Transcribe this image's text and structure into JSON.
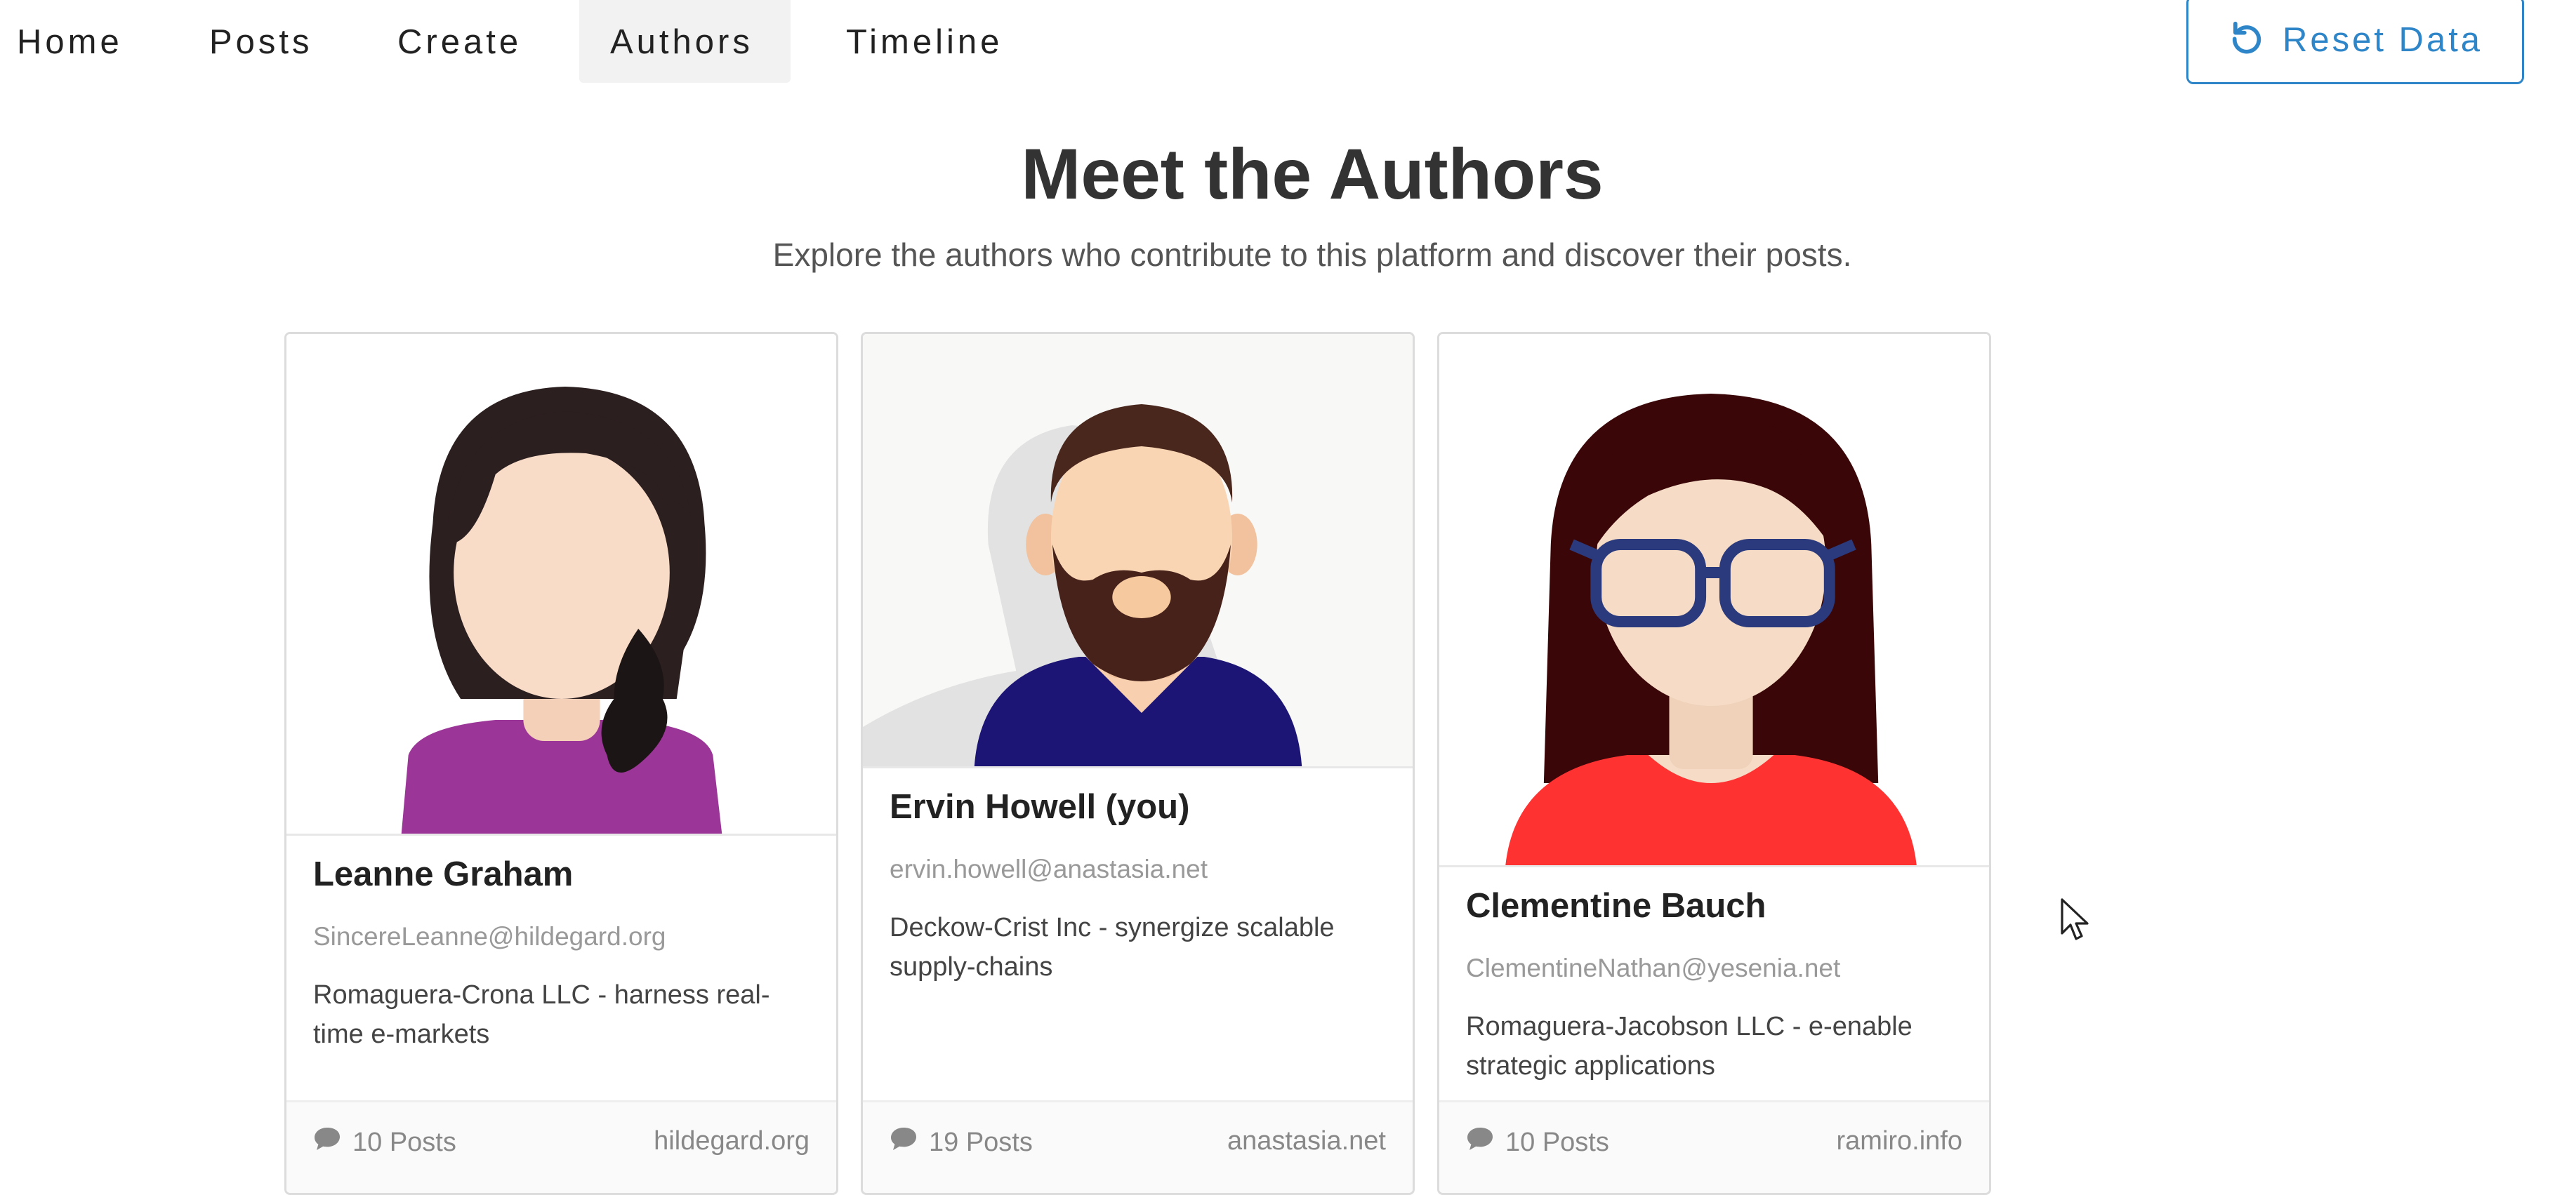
{
  "nav": {
    "items": [
      {
        "label": "Home"
      },
      {
        "label": "Posts"
      },
      {
        "label": "Create"
      },
      {
        "label": "Authors",
        "active": true
      },
      {
        "label": "Timeline"
      }
    ],
    "reset_label": "Reset Data"
  },
  "header": {
    "title": "Meet the Authors",
    "subtitle": "Explore the authors who contribute to this platform and discover their posts."
  },
  "authors": [
    {
      "name": "Leanne Graham",
      "email": "SincereLeanne@hildegard.org",
      "company": "Romaguera-Crona LLC - harness real-time e-markets",
      "posts": "10 Posts",
      "website": "hildegard.org"
    },
    {
      "name": "Ervin Howell (you)",
      "email": "ervin.howell@anastasia.net",
      "company": "Deckow-Crist Inc - synergize scalable supply-chains",
      "posts": "19 Posts",
      "website": "anastasia.net"
    },
    {
      "name": "Clementine Bauch",
      "email": "ClementineNathan@yesenia.net",
      "company": "Romaguera-Jacobson LLC - e-enable strategic applications",
      "posts": "10 Posts",
      "website": "ramiro.info"
    }
  ],
  "colors": {
    "accent": "#2e86c9",
    "active_tab_bg": "#f2f2f2"
  },
  "icons": {
    "reset": "undo-icon",
    "posts": "comment-icon",
    "cursor": "mouse-pointer-icon"
  }
}
